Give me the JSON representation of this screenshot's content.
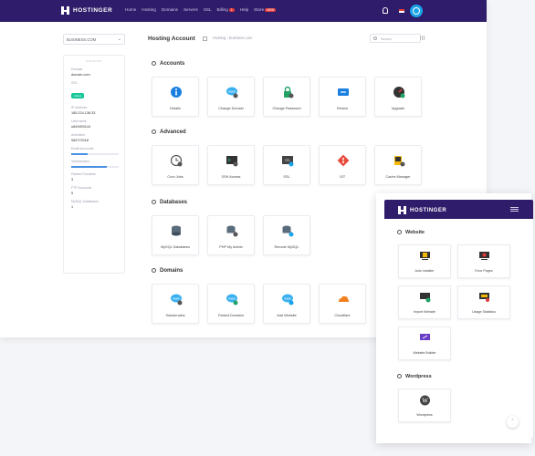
{
  "brand": "HOSTINGER",
  "nav": {
    "links": [
      "Home",
      "Hosting",
      "Domains",
      "Servers",
      "SSL",
      "Billing",
      "Help",
      "Store"
    ],
    "billing_badge": "1",
    "store_badge": "NEW"
  },
  "domain_select": "BUSINESS.COM",
  "account": {
    "header": "ACCOUNT",
    "domain_label": "Domain",
    "domain_value": "domain.com",
    "ssl_label": "SSL",
    "ssl_value": "Active",
    "ip_label": "IP Address",
    "ip_value": "185.224.138.33",
    "username_label": "Username",
    "username_value": "u849453144",
    "activated_label": "Activated",
    "activated_value": "08/07/2018",
    "email_label": "Email Accounts",
    "email_fill": 0.35,
    "subdomains_label": "Subdomains",
    "subdomains_fill": 0.75,
    "parked_label": "Parked Domains",
    "parked_value": "3",
    "ftp_label": "FTP Accounts",
    "ftp_value": "5",
    "mysql_label": "MySQL Databases",
    "mysql_value": "1"
  },
  "header": {
    "title": "Hosting Account",
    "breadcrumb": "Hosting › business.com",
    "search_placeholder": "Search"
  },
  "sections": {
    "accounts": {
      "title": "Accounts",
      "items": [
        "Details",
        "Change Domain",
        "Change Password",
        "Renew",
        "Upgrade"
      ]
    },
    "advanced": {
      "title": "Advanced",
      "items": [
        "Cron Jobs",
        "SSH Access",
        "SSL",
        "GIT",
        "Cache Manager"
      ]
    },
    "databases": {
      "title": "Databases",
      "items": [
        "MySQL Databases",
        "PHP My Admin",
        "Remote MySQL"
      ]
    },
    "domains": {
      "title": "Domains",
      "items": [
        "Subdomains",
        "Parked Domains",
        "Add Website",
        "Cloudflare"
      ]
    }
  },
  "mobile": {
    "brand": "HOSTINGER",
    "website_title": "Website",
    "website_items": [
      "Auto Installer",
      "Error Pages",
      "Import Website",
      "Usage Statistics",
      "Website Builder"
    ],
    "wordpress_title": "Wordpress",
    "wordpress_items": [
      "Wordpress"
    ]
  },
  "colors": {
    "nav_bg": "#2f1c6a",
    "accent": "#1aa3e8",
    "active_badge": "#16c79a",
    "alert": "#e53b3b"
  }
}
